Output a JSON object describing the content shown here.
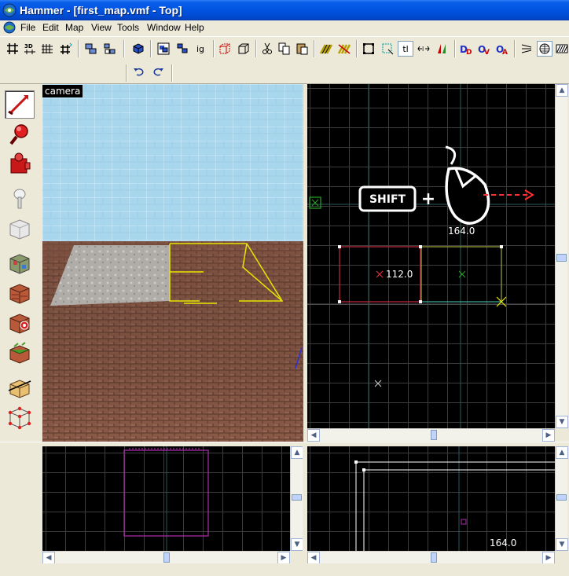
{
  "window": {
    "title": "Hammer - [first_map.vmf - Top]"
  },
  "menu": {
    "items": [
      "File",
      "Edit",
      "Map",
      "View",
      "Tools",
      "Window",
      "Help"
    ]
  },
  "toolbar": {
    "text_button": "tl"
  },
  "tools": {
    "icons": [
      "selection-tool-icon",
      "magnify-tool-icon",
      "camera-tool-icon",
      "entity-tool-icon",
      "block-tool-icon",
      "texture-application-icon",
      "apply-texture-icon",
      "decal-tool-icon",
      "overlay-tool-icon",
      "clipping-tool-icon",
      "vertex-manipulation-icon"
    ]
  },
  "viewports": {
    "camera": {
      "label": "camera"
    },
    "top": {
      "keyboard_hint": "SHIFT",
      "plus": "+",
      "width_readout": "164.0",
      "height_readout": "112.0"
    },
    "side": {
      "width_readout": "164.0"
    }
  },
  "colors": {
    "title_bar": "#0054e3",
    "brush_red": "#c8283c",
    "brush_yellow": "#e6e600",
    "selection_green": "#26a626",
    "arrow_red": "#ff3030"
  }
}
